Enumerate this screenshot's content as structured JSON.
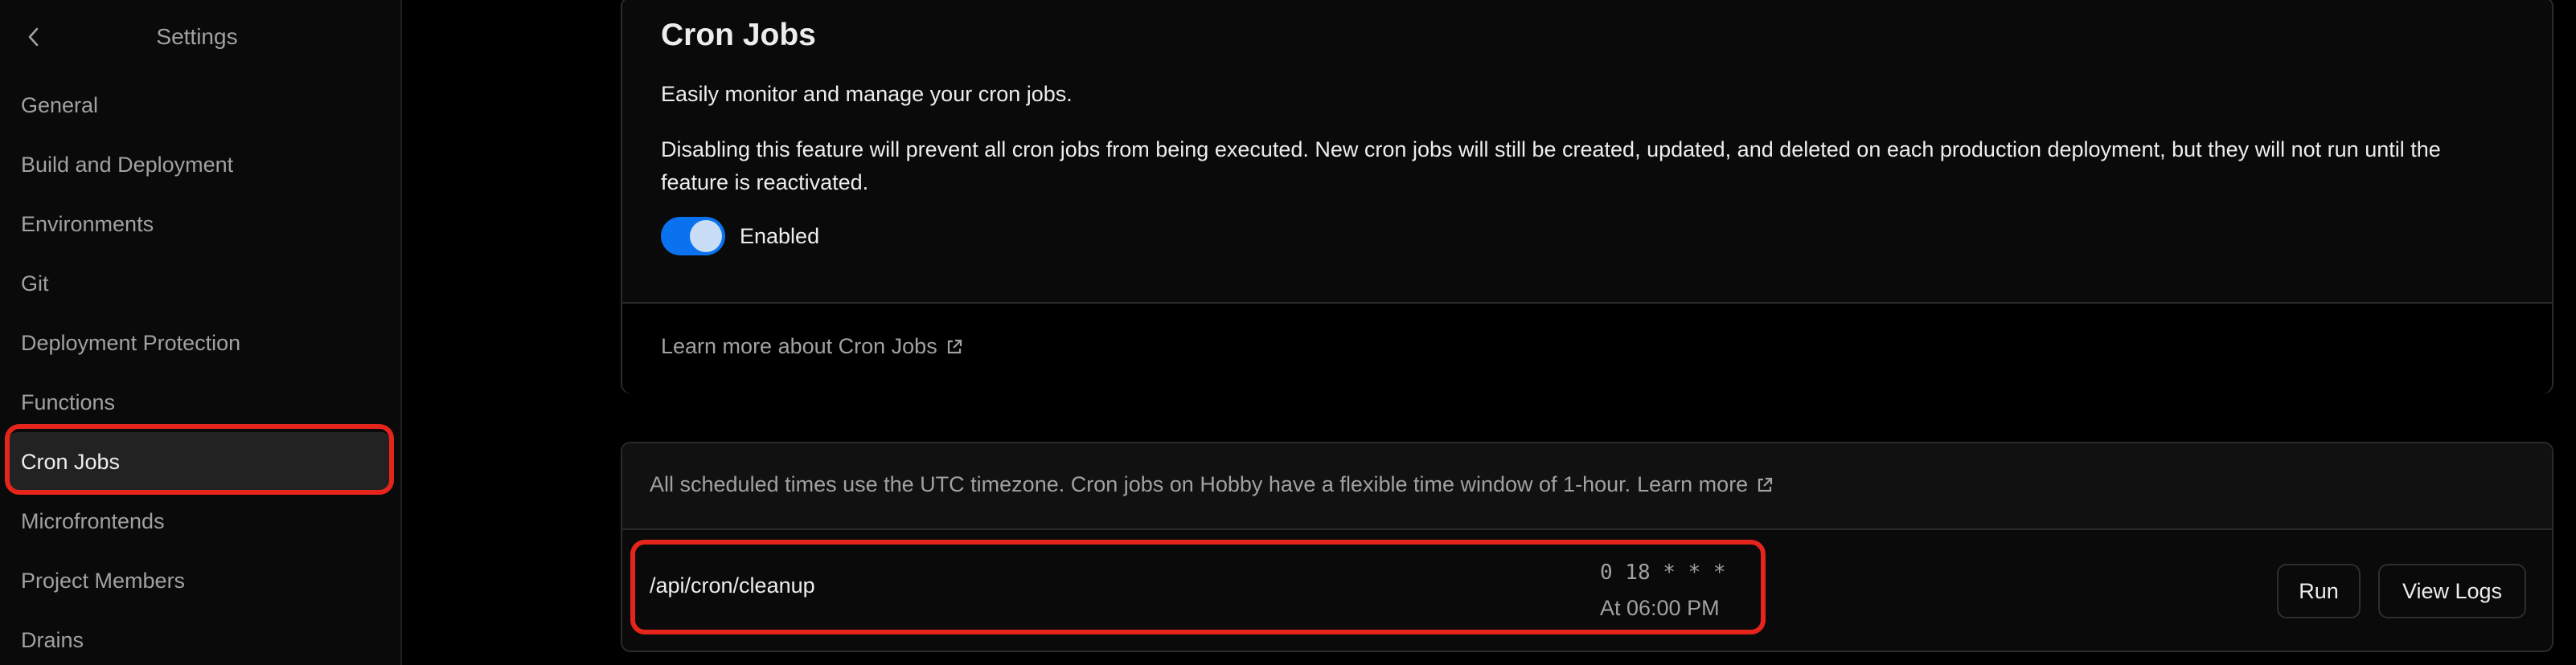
{
  "sidebar": {
    "title": "Settings",
    "items": [
      {
        "label": "General"
      },
      {
        "label": "Build and Deployment"
      },
      {
        "label": "Environments"
      },
      {
        "label": "Git"
      },
      {
        "label": "Deployment Protection"
      },
      {
        "label": "Functions"
      },
      {
        "label": "Cron Jobs",
        "active": true
      },
      {
        "label": "Microfrontends"
      },
      {
        "label": "Project Members"
      },
      {
        "label": "Drains"
      }
    ]
  },
  "cron_card": {
    "title": "Cron Jobs",
    "description": "Easily monitor and manage your cron jobs.",
    "note": "Disabling this feature will prevent all cron jobs from being executed. New cron jobs will still be created, updated, and deleted on each production deployment, but they will not run until the feature is reactivated.",
    "toggle_label": "Enabled",
    "toggle_on": true,
    "learn_more": "Learn more about Cron Jobs"
  },
  "jobs_card": {
    "info": "All scheduled times use the UTC timezone. Cron jobs on Hobby have a flexible time window of 1-hour.",
    "info_link": "Learn more",
    "jobs": [
      {
        "path": "/api/cron/cleanup",
        "schedule": "0 18 * * *",
        "time": "At 06:00 PM",
        "run_label": "Run",
        "logs_label": "View Logs"
      }
    ]
  },
  "colors": {
    "highlight": "#e5241b",
    "toggle_accent": "#0a72ef",
    "background": "#000000"
  }
}
